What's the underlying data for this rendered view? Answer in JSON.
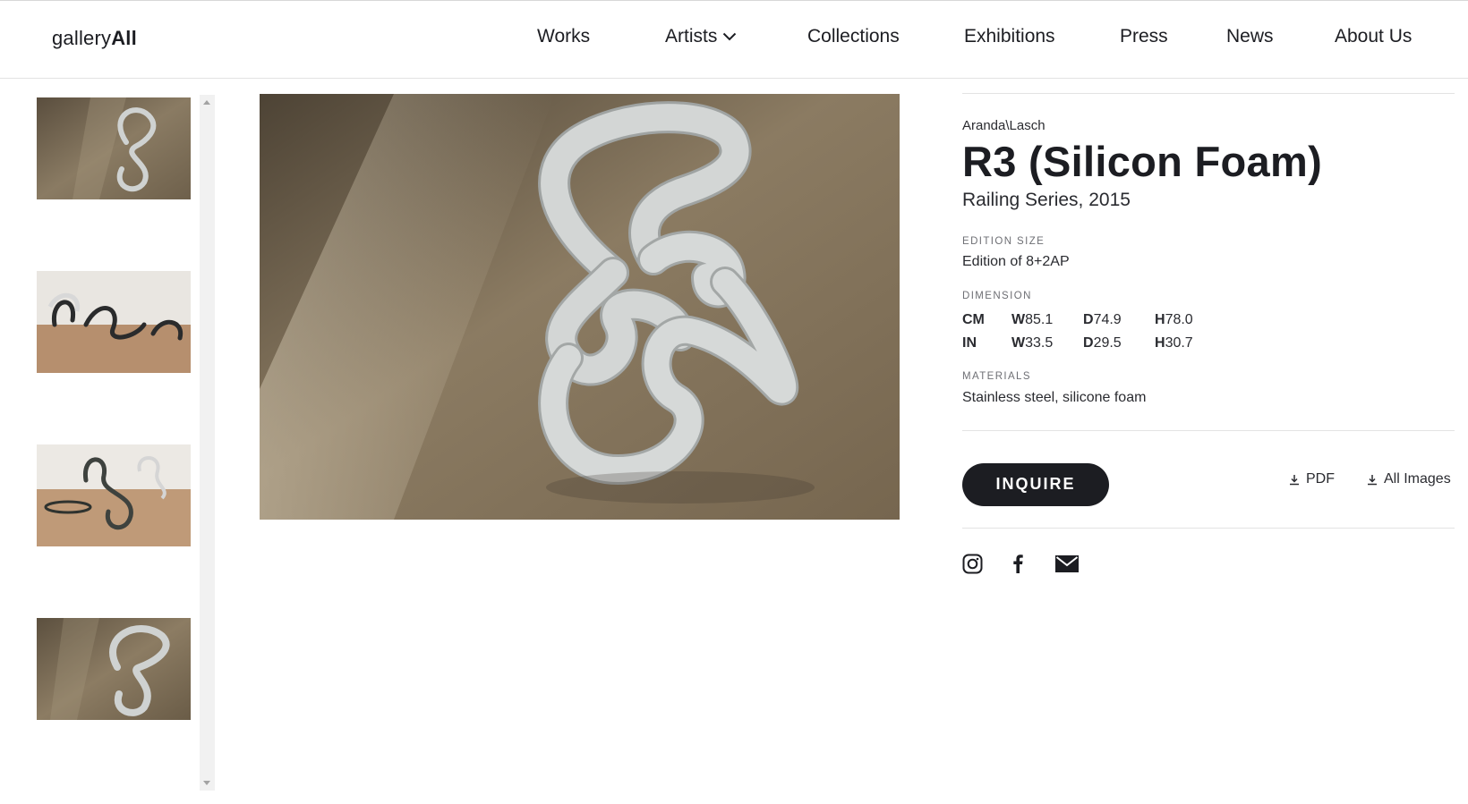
{
  "header": {
    "logo_regular": "gallery",
    "logo_bold": "All",
    "nav": [
      {
        "label": "Works"
      },
      {
        "label": "Artists"
      },
      {
        "label": "Collections"
      },
      {
        "label": "Exhibitions"
      },
      {
        "label": "Press"
      },
      {
        "label": "News"
      },
      {
        "label": "About Us"
      }
    ]
  },
  "artwork": {
    "artist": "Aranda\\Lasch",
    "title": "R3 (Silicon Foam)",
    "series": "Railing Series, 2015",
    "edition_label": "EDITION SIZE",
    "edition_value": "Edition of 8+2AP",
    "dimension_label": "DIMENSION",
    "dimensions": [
      {
        "unit": "CM",
        "w": "85.1",
        "d": "74.9",
        "h": "78.0"
      },
      {
        "unit": "IN",
        "w": "33.5",
        "d": "29.5",
        "h": "30.7"
      }
    ],
    "dim_prefixes": {
      "w": "W",
      "d": "D",
      "h": "H"
    },
    "materials_label": "MATERIALS",
    "materials_value": "Stainless steel, silicone foam"
  },
  "actions": {
    "inquire_label": "INQUIRE",
    "pdf_label": "PDF",
    "all_images_label": "All Images"
  },
  "icons": {
    "social": [
      "instagram-icon",
      "facebook-icon",
      "email-icon"
    ],
    "download": "download-icon",
    "chevron": "chevron-down-icon"
  },
  "colors": {
    "primary_dark": "#1c1d22",
    "floor_brown": "#8a7a62",
    "sculpture_gray": "#cdd0cf"
  }
}
